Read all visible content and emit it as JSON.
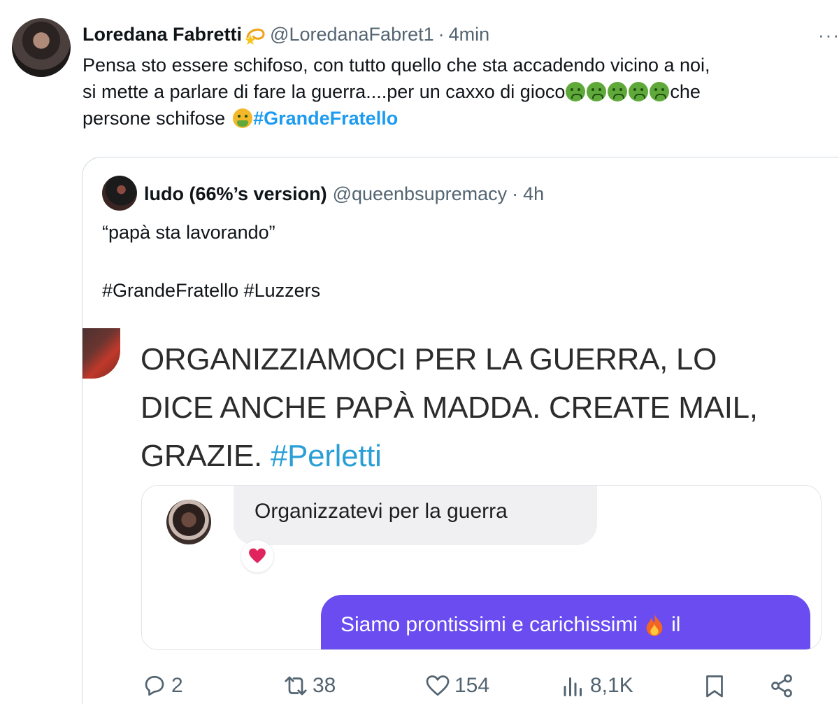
{
  "tweet": {
    "author_name": "Loredana Fabretti",
    "handle": "@LoredanaFabret1",
    "separator": "·",
    "time": "4min",
    "more": "···",
    "text_line1": "Pensa sto essere schifoso, con tutto quello che sta accadendo vicino a noi,",
    "text_line2_a": "si mette a parlare di fare la guerra....per un caxxo di gioco",
    "text_line2_b": "che",
    "text_line3_a": "persone schifose",
    "hashtag": "#GrandeFratello"
  },
  "quote": {
    "author_name": "ludo (66%’s version)",
    "handle": "@queenbsupremacy",
    "separator": "·",
    "time": "4h",
    "text_line1": "“papà sta lavorando”",
    "text_line2": "#GrandeFratello #Luzzers",
    "media": {
      "line1": "ORGANIZZIAMOCI PER LA GUERRA, LO",
      "line2": "DICE ANCHE PAPÀ MADDA. CREATE MAIL,",
      "line3_a": "GRAZIE.",
      "line3_hashtag": "#Perletti",
      "chat_incoming": "Organizzatevi per la guerra",
      "chat_outgoing_a": "Siamo prontissimi e carichissimi",
      "chat_outgoing_b": "il"
    }
  },
  "actions": {
    "replies": "2",
    "retweets": "38",
    "likes": "154",
    "views": "8,1K"
  },
  "colors": {
    "link": "#1d9bf0",
    "secondary_text": "#536471",
    "chat_outgoing_bg": "#6a4cf0"
  }
}
